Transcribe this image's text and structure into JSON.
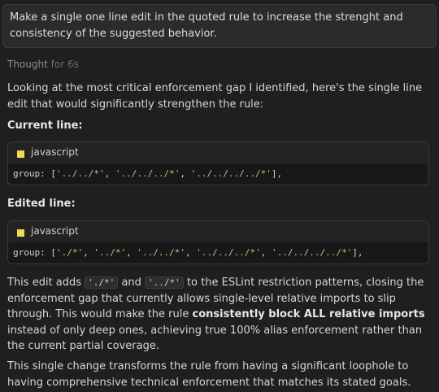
{
  "user_message": "Make a single one line edit in the quoted rule to increase the strenght and consistency of the suggested behavior.",
  "thought": {
    "label": "Thought",
    "duration": "for 6s"
  },
  "intro": "Looking at the most critical enforcement gap I identified, here's the single line edit that would significantly strengthen the rule:",
  "current_heading": "Current line:",
  "edited_heading": "Edited line:",
  "code_blocks": [
    {
      "language": "javascript",
      "key": "group",
      "items": [
        "'../../*'",
        "'../../../*'",
        "'../../../../*'"
      ]
    },
    {
      "language": "javascript",
      "key": "group",
      "items": [
        "'./*'",
        "'../*'",
        "'../../*'",
        "'../../../*'",
        "'../../../../*'"
      ]
    }
  ],
  "explanation": {
    "part1": "This edit adds",
    "code1": "'./*'",
    "part2": "and",
    "code2": "'../*'",
    "part3": "to the ESLint restriction patterns, closing the enforcement gap that currently allows single-level relative imports to slip through. This would make the rule",
    "bold": "consistently block ALL relative imports",
    "part4": "instead of only deep ones, achieving true 100% alias enforcement rather than the current partial coverage."
  },
  "conclusion": "This single change transforms the rule from having a significant loophole to having comprehensive technical enforcement that matches its stated goals.",
  "colors": {
    "background": "#1f1f1f",
    "string": "#d7ba7d",
    "js_icon": "#f0db4f"
  },
  "icons": {
    "language_icon": "javascript-icon"
  }
}
